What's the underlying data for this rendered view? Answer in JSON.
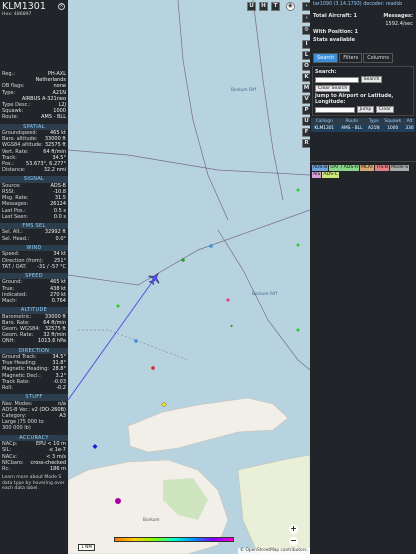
{
  "aircraft": {
    "callsign": "KLM1301",
    "hex_line": "Hex: 486897"
  },
  "left_rows_top": [
    {
      "k": "Reg.:",
      "v": "PH-AXL"
    },
    {
      "k": "",
      "v": "Netherlands"
    },
    {
      "k": "DB flags:",
      "v": "none"
    },
    {
      "k": "Type:",
      "v": "A21N"
    },
    {
      "k": "",
      "v": "AIRBUS A-321neo"
    },
    {
      "k": "Type Desc.:",
      "v": "L2J"
    },
    {
      "k": "Squawk:",
      "v": "1000"
    },
    {
      "k": "Route:",
      "v": "AMS - BLL"
    }
  ],
  "sections": [
    {
      "title": "SPATIAL",
      "rows": [
        {
          "k": "Groundspeed:",
          "v": "465 kt"
        },
        {
          "k": "Baro. altitude:",
          "v": "33000 ft"
        },
        {
          "k": "WGS84 altitude:",
          "v": "32575 ft"
        },
        {
          "k": "Vert. Rate:",
          "v": "64 ft/min"
        },
        {
          "k": "Track:",
          "v": "34.5°"
        },
        {
          "k": "Pos.:",
          "v": "53.673°, 6.277°"
        },
        {
          "k": "Distance:",
          "v": "32.2 nmi"
        }
      ]
    },
    {
      "title": "SIGNAL",
      "rows": [
        {
          "k": "Source:",
          "v": "ADS-B"
        },
        {
          "k": "RSSI:",
          "v": "-10.8"
        },
        {
          "k": "Msg. Rate:",
          "v": "31.5"
        },
        {
          "k": "Messages:",
          "v": "26124"
        },
        {
          "k": "Last Pos.:",
          "v": "0.5 s"
        },
        {
          "k": "Last Seen:",
          "v": "0.0 s"
        }
      ]
    },
    {
      "title": "FMS SEL",
      "rows": [
        {
          "k": "Sel. Alt.:",
          "v": "32992 ft"
        },
        {
          "k": "Sel. Head.:",
          "v": "0.0°"
        }
      ]
    },
    {
      "title": "WIND",
      "rows": [
        {
          "k": "Speed:",
          "v": "34 kt"
        },
        {
          "k": "Direction (from):",
          "v": "251°"
        },
        {
          "k": "TAT / OAT:",
          "v": "-31 / -57 °C"
        }
      ]
    },
    {
      "title": "SPEED",
      "rows": [
        {
          "k": "Ground:",
          "v": "465 kt"
        },
        {
          "k": "True:",
          "v": "438 kt"
        },
        {
          "k": "Indicated:",
          "v": "270 kt"
        },
        {
          "k": "Mach:",
          "v": "0.764"
        }
      ]
    },
    {
      "title": "ALTITUDE",
      "rows": [
        {
          "k": "Barometric:",
          "v": "33000 ft"
        },
        {
          "k": "Baro. Rate:",
          "v": "64 ft/min"
        },
        {
          "k": "Geom. WGS84:",
          "v": "32575 ft"
        },
        {
          "k": "Geom. Rate:",
          "v": "32 ft/min"
        },
        {
          "k": "QNH:",
          "v": "1013.6 hPa"
        }
      ]
    },
    {
      "title": "DIRECTION",
      "rows": [
        {
          "k": "Ground Track:",
          "v": "34.5°"
        },
        {
          "k": "True Heading:",
          "v": "31.8°"
        },
        {
          "k": "Magnetic Heading:",
          "v": "28.8°"
        },
        {
          "k": "Magnetic Decl.:",
          "v": "3.2°"
        },
        {
          "k": "Track Rate:",
          "v": "-0.03"
        },
        {
          "k": "Roll:",
          "v": "-0.2"
        }
      ]
    },
    {
      "title": "STUFF",
      "rows": [
        {
          "k": "Nav. Modes:",
          "v": "n/a"
        },
        {
          "k": "ADS-B Ver.:",
          "v": "v2 (DO-260B)"
        },
        {
          "k": "Category:",
          "v": "A3"
        },
        {
          "k": "Large (75 000 to",
          "v": ""
        },
        {
          "k": "300 000 lb)",
          "v": ""
        }
      ]
    },
    {
      "title": "ACCURACY",
      "rows": [
        {
          "k": "NACp:",
          "v": "EPU < 10 m"
        },
        {
          "k": "SIL:",
          "v": "≤ 1e-7"
        },
        {
          "k": "NACv:",
          "v": "< 3 m/s"
        },
        {
          "k": "NICbaro:",
          "v": "cross-checked"
        },
        {
          "k": "Rc:",
          "v": "186 m"
        }
      ]
    }
  ],
  "left_note": "Learn more about Mode S data type by hovering over each data label.",
  "map": {
    "labels": [
      "Borkum Riff",
      "Borkum Riff",
      "Borkum"
    ],
    "scale": "1 NM",
    "credit": "© OpenStreetMap contributors.",
    "top_buttons": [
      "U",
      "H",
      "T"
    ],
    "side_buttons": [
      "I",
      "L",
      "O",
      "K",
      "M",
      "V",
      "P",
      "U",
      "F",
      "R"
    ]
  },
  "right": {
    "version": "tar1090 (3.14.1793) decoder: readsb",
    "total_aircraft": "Total Aircraft: 1",
    "messages_label": "Messages:",
    "messages_value": "1592.4/sec",
    "with_position": "With Position: 1",
    "stats_line": "Stats available",
    "tabs": [
      "Search",
      "Filters",
      "Columns"
    ],
    "search_label": "Search:",
    "search_button": "Search",
    "clear_search": "Clear Search",
    "jump_label": "Jump to Airport or Latitude, Longitude:",
    "jump_button": "Jump",
    "clear_button": "Clear",
    "columns": [
      "Callsign",
      "Route",
      "Type",
      "Squawk",
      "Alt"
    ],
    "row": [
      "KLM1301",
      "AMS - BLL",
      "A21N",
      "1000",
      "330"
    ],
    "badges": [
      "ADS-B",
      "UAT / ADS-R",
      "MLAT",
      "TIS-B",
      "Mode-S",
      "AIS",
      "ADS-C"
    ]
  },
  "colors": {
    "accent": "#3a8fd8",
    "section_bg": "#2c3e4d",
    "panel_bg": "#212529",
    "sea": "#b6d3df",
    "land": "#f2efe9",
    "border_line": "#7a6a8c",
    "track": "#4a4ad8"
  }
}
